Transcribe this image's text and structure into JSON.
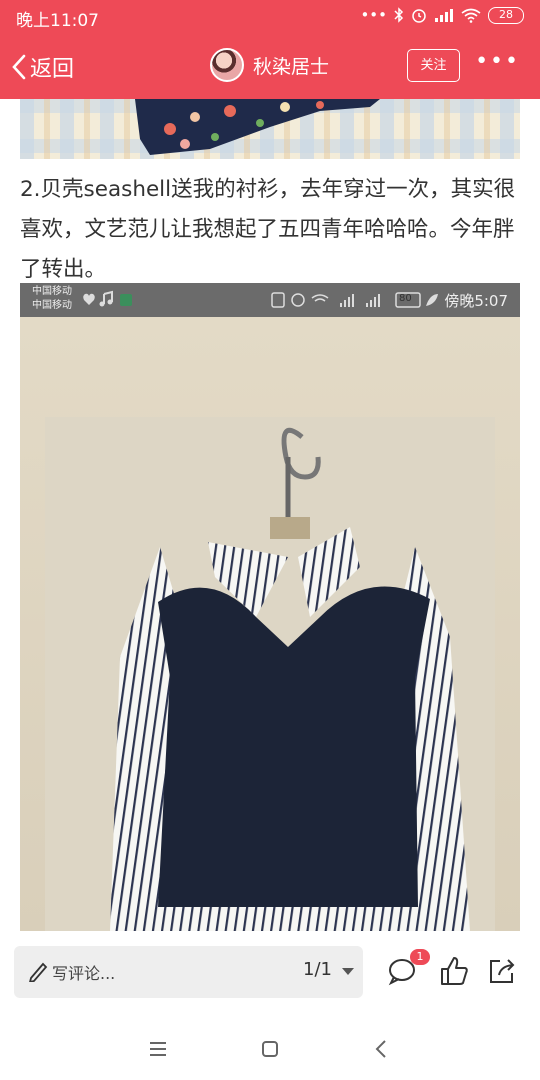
{
  "status_bar": {
    "time": "晚上11:07",
    "icons": [
      "more-dots-icon",
      "bluetooth-icon",
      "alarm-icon",
      "signal-icon",
      "wifi-icon"
    ],
    "battery": "28"
  },
  "nav": {
    "back_label": "返回",
    "author_name": "秋染居士",
    "follow_label": "关注"
  },
  "post": {
    "paragraph": "2.贝壳seashell送我的衬衫，去年穿过一次，其实很喜欢，文艺范儿让我想起了五四青年哈哈哈。今年胖了转出。"
  },
  "embedded_screenshot": {
    "carrier_line1": "中国移动",
    "carrier_line2": "中国移动",
    "battery": "80",
    "time": "傍晚5:07"
  },
  "toolbar": {
    "comment_placeholder": "写评论...",
    "pager": "1/1",
    "comment_badge": "1"
  },
  "colors": {
    "accent": "#ee4a57"
  }
}
